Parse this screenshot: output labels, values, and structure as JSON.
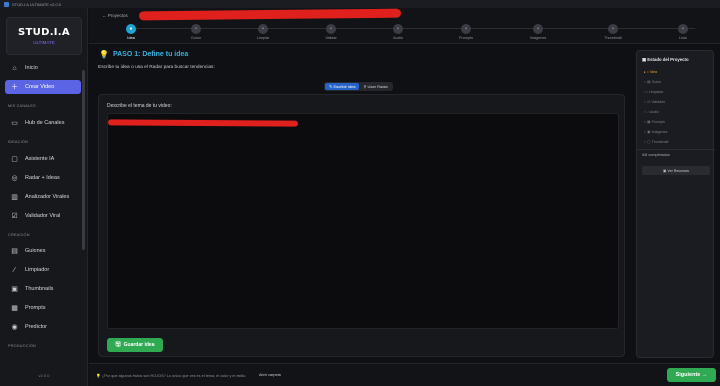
{
  "window": {
    "title": "STUD.I.A ULTIMATE v2.0.0"
  },
  "sidebar": {
    "logo_name": "STUD.I.A",
    "logo_badge": "ULTIMATE",
    "items": [
      {
        "label": "Inicio",
        "icon": "home-icon"
      },
      {
        "label": "Crear Video",
        "icon": "plus-icon",
        "active": true
      },
      {
        "label": "Hub de Canales",
        "icon": "tv-icon"
      },
      {
        "label": "Asistente IA",
        "icon": "chat-icon"
      },
      {
        "label": "Radar + Ideas",
        "icon": "radar-icon"
      },
      {
        "label": "Analizador Virales",
        "icon": "chart-icon"
      },
      {
        "label": "Validador Viral",
        "icon": "check-icon"
      },
      {
        "label": "Guiones",
        "icon": "doc-icon"
      },
      {
        "label": "Limpiador",
        "icon": "brush-icon"
      },
      {
        "label": "Thumbnails",
        "icon": "image-icon"
      },
      {
        "label": "Prompts",
        "icon": "prompt-icon"
      },
      {
        "label": "Predictor",
        "icon": "target-icon"
      }
    ],
    "sections": [
      "MIS CANALES",
      "IDEACIÓN",
      "CREACIÓN",
      "PRODUCCIÓN"
    ],
    "version": "v2.0.0"
  },
  "header": {
    "back_label": "← Proyectos",
    "steps": [
      {
        "label": "Idea",
        "active": true
      },
      {
        "label": "Guion"
      },
      {
        "label": "Limpiar"
      },
      {
        "label": "Validar"
      },
      {
        "label": "Audio"
      },
      {
        "label": "Prompts"
      },
      {
        "label": "Imágenes"
      },
      {
        "label": "Thumbnail"
      },
      {
        "label": "Listo"
      }
    ]
  },
  "main": {
    "title": "PASO 1: Define tu idea",
    "subtitle": "Escribe tu idea o usa el Radar para buscar tendencias:",
    "toggle": {
      "write": "✎ Escribir idea",
      "radar": "⚲ Usar Radar"
    },
    "textarea_label": "Describe el tema de tu video:",
    "save_label": "Guardar idea"
  },
  "right_panel": {
    "title": "Estado del Proyecto",
    "items": [
      "Idea",
      "Guion",
      "Limpiado",
      "Validado",
      "Audio",
      "Prompts",
      "Imágenes",
      "Thumbnail"
    ],
    "completed": "0/8 completados",
    "button": "Ver Recursos"
  },
  "footer": {
    "tip": "¿Por qué algunos frutos son ROJOS? Lo único que ves es el tema, el color y el estilo.",
    "link": "Abrir carpeta",
    "next_label": "Siguiente →"
  },
  "colors": {
    "accent": "#5c64e6",
    "step_active": "#1aa7d6",
    "success": "#2faa53",
    "warning": "#e8a13a"
  }
}
